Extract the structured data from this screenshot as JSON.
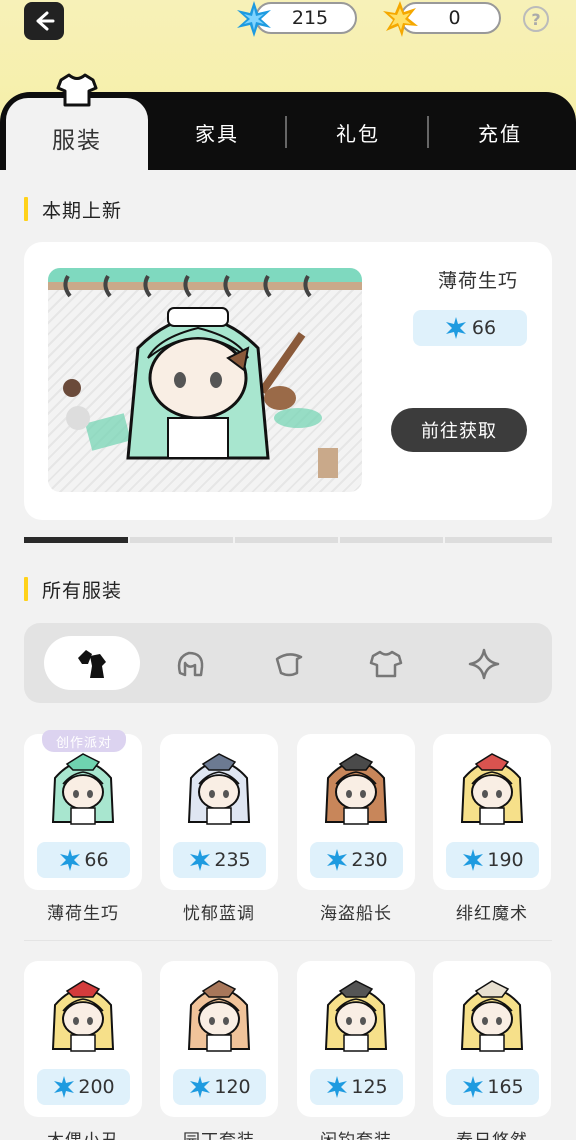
{
  "header": {
    "currencies": [
      {
        "name": "blue-crystal",
        "value": "215",
        "color": "#29a8e0"
      },
      {
        "name": "gold-star",
        "value": "0",
        "color": "#f5b800"
      }
    ],
    "help_label": "?"
  },
  "tabs": [
    {
      "label": "服装",
      "active": true
    },
    {
      "label": "家具",
      "active": false
    },
    {
      "label": "礼包",
      "active": false
    },
    {
      "label": "充值",
      "active": false
    }
  ],
  "new_section": {
    "title": "本期上新",
    "featured": {
      "name": "薄荷生巧",
      "price": "66",
      "cta": "前往获取"
    },
    "pager": {
      "pages": 5,
      "current": 1
    }
  },
  "all_section": {
    "title": "所有服装",
    "filters": [
      {
        "icon": "all-outfits-icon",
        "active": true
      },
      {
        "icon": "hair-icon",
        "active": false
      },
      {
        "icon": "hat-icon",
        "active": false
      },
      {
        "icon": "shirt-icon",
        "active": false
      },
      {
        "icon": "sparkle-icon",
        "active": false
      }
    ],
    "items": [
      {
        "name": "薄荷生巧",
        "price": "66",
        "tag": "创作派对",
        "hair": "#a8e6cf",
        "accent": "#6fd3b0"
      },
      {
        "name": "忧郁蓝调",
        "price": "235",
        "tag": "",
        "hair": "#dfe6f2",
        "accent": "#6c7a92"
      },
      {
        "name": "海盗船长",
        "price": "230",
        "tag": "",
        "hair": "#c8865a",
        "accent": "#4a4a4a"
      },
      {
        "name": "绯红魔术",
        "price": "190",
        "tag": "",
        "hair": "#f6e08a",
        "accent": "#d9534f"
      },
      {
        "name": "木偶小丑",
        "price": "200",
        "tag": "",
        "hair": "#f6e08a",
        "accent": "#d33c3c"
      },
      {
        "name": "园丁套装",
        "price": "120",
        "tag": "",
        "hair": "#f0c39a",
        "accent": "#a8775a"
      },
      {
        "name": "闲钓套装",
        "price": "125",
        "tag": "",
        "hair": "#f6e08a",
        "accent": "#555555"
      },
      {
        "name": "春日悠然",
        "price": "165",
        "tag": "",
        "hair": "#f6e08a",
        "accent": "#e8e0d0"
      }
    ]
  }
}
